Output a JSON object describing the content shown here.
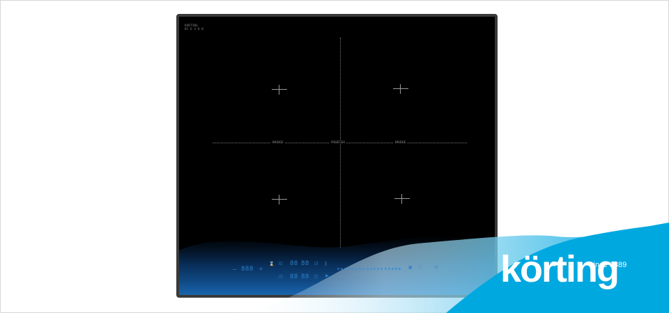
{
  "hob": {
    "badge_line1": "KORTING",
    "badge_line2": "HI 6 4 0 B",
    "zone_label_left": "BRIDGE",
    "zone_label_center": "FREEFLEX",
    "zone_label_right": "BRIDGE"
  },
  "controls": {
    "minus": "−",
    "timer_display": "888",
    "plus": "+",
    "display_top_1": "88",
    "display_top_2": "88",
    "display_bottom_1": "88",
    "display_bottom_2": "88",
    "slider_dots": 18
  },
  "brand": {
    "name": "körting",
    "tagline": "since 1889",
    "color": "#00a8e0"
  }
}
